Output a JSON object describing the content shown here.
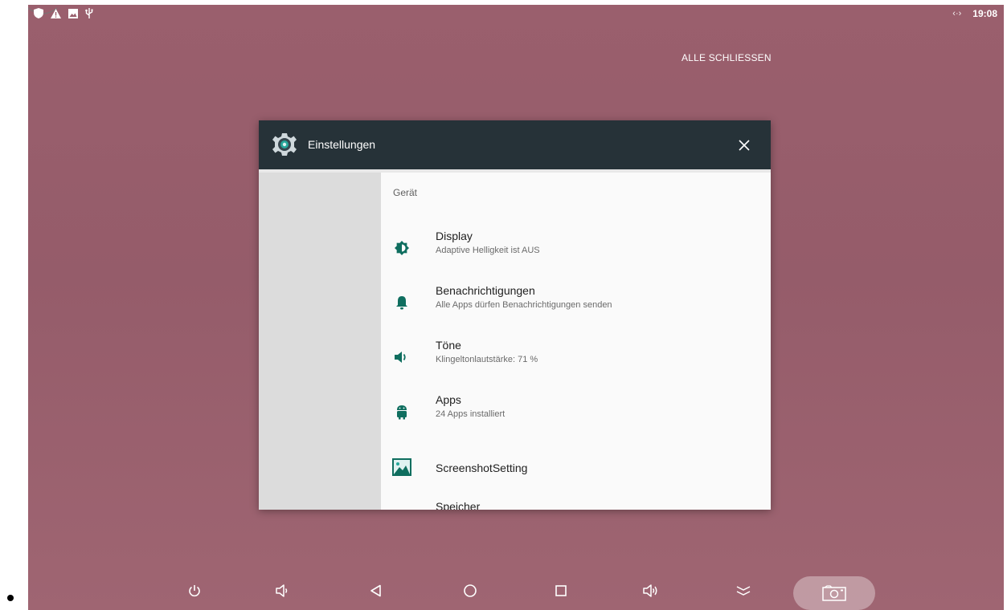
{
  "status_bar": {
    "icons": [
      "shield-icon",
      "warning-icon",
      "image-icon",
      "usb-icon"
    ],
    "data_indicator": "‹·›",
    "time": "19:08"
  },
  "recents": {
    "clear_all_label": "ALLE SCHLIESSEN"
  },
  "app_card": {
    "title": "Einstellungen",
    "section_header": "Gerät",
    "items": [
      {
        "icon": "brightness-icon",
        "title": "Display",
        "summary": "Adaptive Helligkeit ist AUS"
      },
      {
        "icon": "bell-icon",
        "title": "Benachrichtigungen",
        "summary": "Alle Apps dürfen Benachrichtigungen senden"
      },
      {
        "icon": "volume-icon",
        "title": "Töne",
        "summary": "Klingeltonlautstärke: 71 %"
      },
      {
        "icon": "android-icon",
        "title": "Apps",
        "summary": "24 Apps installiert"
      },
      {
        "icon": "screenshot-icon",
        "title": "ScreenshotSetting",
        "summary": ""
      },
      {
        "icon": "storage-icon",
        "title": "Speicher",
        "summary": ""
      }
    ]
  },
  "nav_bar": {
    "buttons": [
      "power-icon",
      "volume-down-icon",
      "back-icon",
      "home-icon",
      "recents-icon",
      "volume-up-icon",
      "collapse-icon",
      "screenshot-camera-icon"
    ]
  },
  "colors": {
    "wallpaper": "#9a5f6d",
    "header": "#263238",
    "accent": "#0f6e5f"
  }
}
